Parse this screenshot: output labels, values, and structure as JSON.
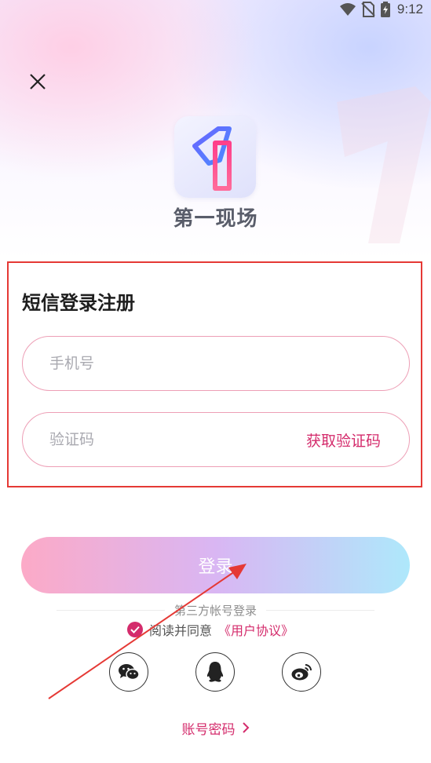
{
  "status_bar": {
    "time": "9:12"
  },
  "app": {
    "name": "第一现场"
  },
  "form": {
    "title": "短信登录注册",
    "phone_placeholder": "手机号",
    "code_placeholder": "验证码",
    "get_code_label": "获取验证码"
  },
  "login_button": "登录",
  "third_party": {
    "label": "第三方帐号登录"
  },
  "agreement": {
    "prefix": "阅读并同意",
    "link": "《用户协议》",
    "checked": true
  },
  "social_icons": [
    "wechat-icon",
    "qq-icon",
    "weibo-icon"
  ],
  "account_login": "账号密码",
  "colors": {
    "accent": "#d42c6c",
    "field_border": "#ed9fb6",
    "highlight_box": "#e53935",
    "button_gradient_start": "#fcaac7",
    "button_gradient_end": "#aee8fb"
  }
}
